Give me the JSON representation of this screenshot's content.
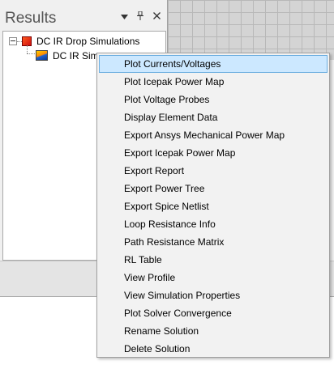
{
  "results_panel": {
    "title": "Results",
    "buttons": {
      "dropdown_glyph": "▼",
      "pin_glyph": "📌",
      "close_glyph": "✕"
    },
    "tree": {
      "root": {
        "label": "DC IR Drop Simulations",
        "icon": "red-square-icon"
      },
      "child": {
        "label": "DC IR Sim",
        "icon": "simulation-result-icon"
      }
    }
  },
  "context_menu": {
    "highlighted_index": 0,
    "items": [
      {
        "label": "Plot Currents/Voltages"
      },
      {
        "label": "Plot Icepak Power Map"
      },
      {
        "label": "Plot Voltage Probes"
      },
      {
        "label": "Display Element Data"
      },
      {
        "label": "Export Ansys Mechanical Power Map"
      },
      {
        "label": "Export Icepak Power Map"
      },
      {
        "label": "Export Report"
      },
      {
        "label": "Export Power Tree"
      },
      {
        "label": "Export Spice Netlist"
      },
      {
        "label": "Loop Resistance Info"
      },
      {
        "label": "Path Resistance Matrix"
      },
      {
        "label": "RL Table"
      },
      {
        "label": "View Profile"
      },
      {
        "label": "View Simulation Properties"
      },
      {
        "label": "Plot Solver Convergence"
      },
      {
        "label": "Rename Solution"
      },
      {
        "label": "Delete Solution"
      }
    ]
  },
  "colors": {
    "highlight_fill": "#cce8ff",
    "highlight_border": "#6caee0",
    "menu_background": "#f2f2f2"
  }
}
